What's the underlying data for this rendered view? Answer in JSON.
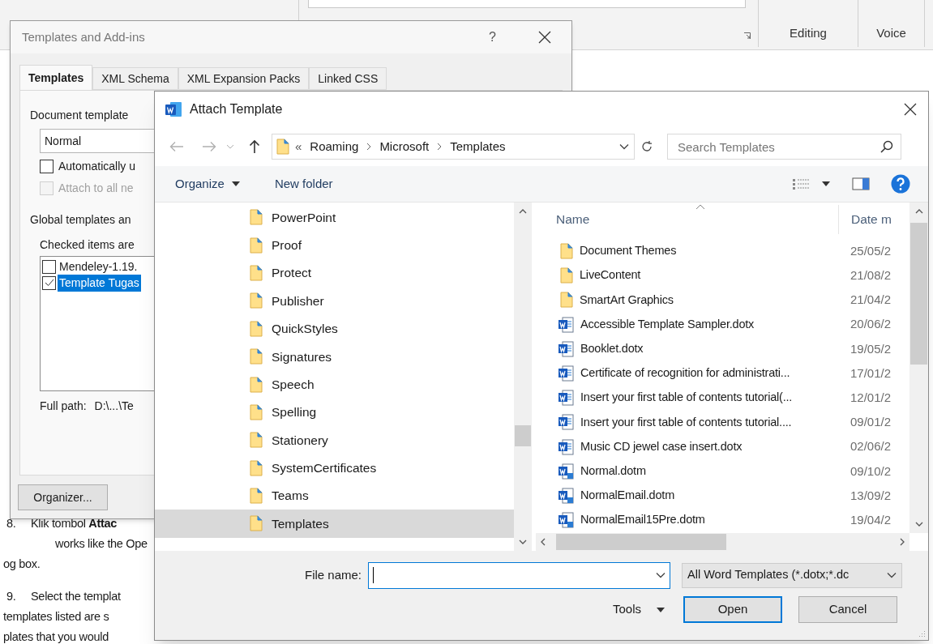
{
  "word": {
    "ribbon_groups": [
      {
        "label": "Editing"
      },
      {
        "label": "Voice"
      }
    ],
    "document_lines": [
      {
        "kind": "numbered",
        "number": "8.",
        "text": "Klik tombol **Attac**"
      },
      {
        "kind": "hanging",
        "text": "works like the Ope"
      },
      {
        "kind": "plain",
        "text": "og box."
      },
      {
        "kind": "numbered",
        "number": "9.",
        "text": "Select the templat"
      },
      {
        "kind": "plain",
        "text": "templates listed are s"
      },
      {
        "kind": "plain",
        "text": "plates that you would"
      }
    ]
  },
  "templates_dialog": {
    "title": "Templates and Add-ins",
    "help": "?",
    "tabs": [
      {
        "label": "Templates",
        "selected": true
      },
      {
        "label": "XML Schema",
        "selected": false
      },
      {
        "label": "XML Expansion Packs",
        "selected": false
      },
      {
        "label": "Linked CSS",
        "selected": false
      }
    ],
    "document_template_label": "Document template",
    "document_template": "Normal",
    "options": [
      {
        "label": "Automatically u",
        "checked": false,
        "disabled": false
      },
      {
        "label": "Attach to all ne",
        "checked": false,
        "disabled": true
      }
    ],
    "global_label": "Global templates an",
    "checked_note": "Checked items are",
    "global_items": [
      {
        "label": "Mendeley-1.19.",
        "checked": false,
        "selected": false
      },
      {
        "label": "Template Tugas",
        "checked": true,
        "selected": true
      }
    ],
    "full_path_label": "Full path:",
    "full_path": "D:\\...\\Te",
    "organizer_button": "Organizer..."
  },
  "attach_dialog": {
    "title": "Attach Template",
    "path_prefix": "«",
    "path": [
      "Roaming",
      "Microsoft",
      "Templates"
    ],
    "search_placeholder": "Search Templates",
    "toolbar": {
      "organize": "Organize",
      "new_folder": "New folder"
    },
    "folders": [
      {
        "name": "PowerPoint",
        "selected": false
      },
      {
        "name": "Proof",
        "selected": false
      },
      {
        "name": "Protect",
        "selected": false
      },
      {
        "name": "Publisher",
        "selected": false
      },
      {
        "name": "QuickStyles",
        "selected": false
      },
      {
        "name": "Signatures",
        "selected": false
      },
      {
        "name": "Speech",
        "selected": false
      },
      {
        "name": "Spelling",
        "selected": false
      },
      {
        "name": "Stationery",
        "selected": false
      },
      {
        "name": "SystemCertificates",
        "selected": false
      },
      {
        "name": "Teams",
        "selected": false
      },
      {
        "name": "Templates",
        "selected": true
      }
    ],
    "columns": [
      "Name",
      "Date m"
    ],
    "files": [
      {
        "kind": "folder",
        "name": "Document Themes",
        "date": "25/05/2"
      },
      {
        "kind": "folder",
        "name": "LiveContent",
        "date": "21/08/2"
      },
      {
        "kind": "folder",
        "name": "SmartArt Graphics",
        "date": "21/04/2"
      },
      {
        "kind": "template",
        "name": "Accessible Template Sampler.dotx",
        "date": "20/06/2"
      },
      {
        "kind": "template",
        "name": "Booklet.dotx",
        "date": "19/05/2"
      },
      {
        "kind": "template",
        "name": "Certificate of recognition for administrati...",
        "date": "17/01/2"
      },
      {
        "kind": "template",
        "name": "Insert your first table of contents tutorial(...",
        "date": "12/01/2"
      },
      {
        "kind": "template",
        "name": "Insert your first table of contents tutorial....",
        "date": "09/01/2"
      },
      {
        "kind": "template",
        "name": "Music CD jewel case insert.dotx",
        "date": "02/06/2"
      },
      {
        "kind": "macro_template",
        "name": "Normal.dotm",
        "date": "09/10/2"
      },
      {
        "kind": "macro_template",
        "name": "NormalEmail.dotm",
        "date": "13/09/2"
      },
      {
        "kind": "macro_template",
        "name": "NormalEmail15Pre.dotm",
        "date": "19/04/2"
      }
    ],
    "file_name_label": "File name:",
    "file_type": "All Word Templates (*.dotx;*.dc",
    "tools": "Tools",
    "buttons": [
      {
        "label": "Open",
        "default": true
      },
      {
        "label": "Cancel",
        "default": false
      }
    ]
  }
}
